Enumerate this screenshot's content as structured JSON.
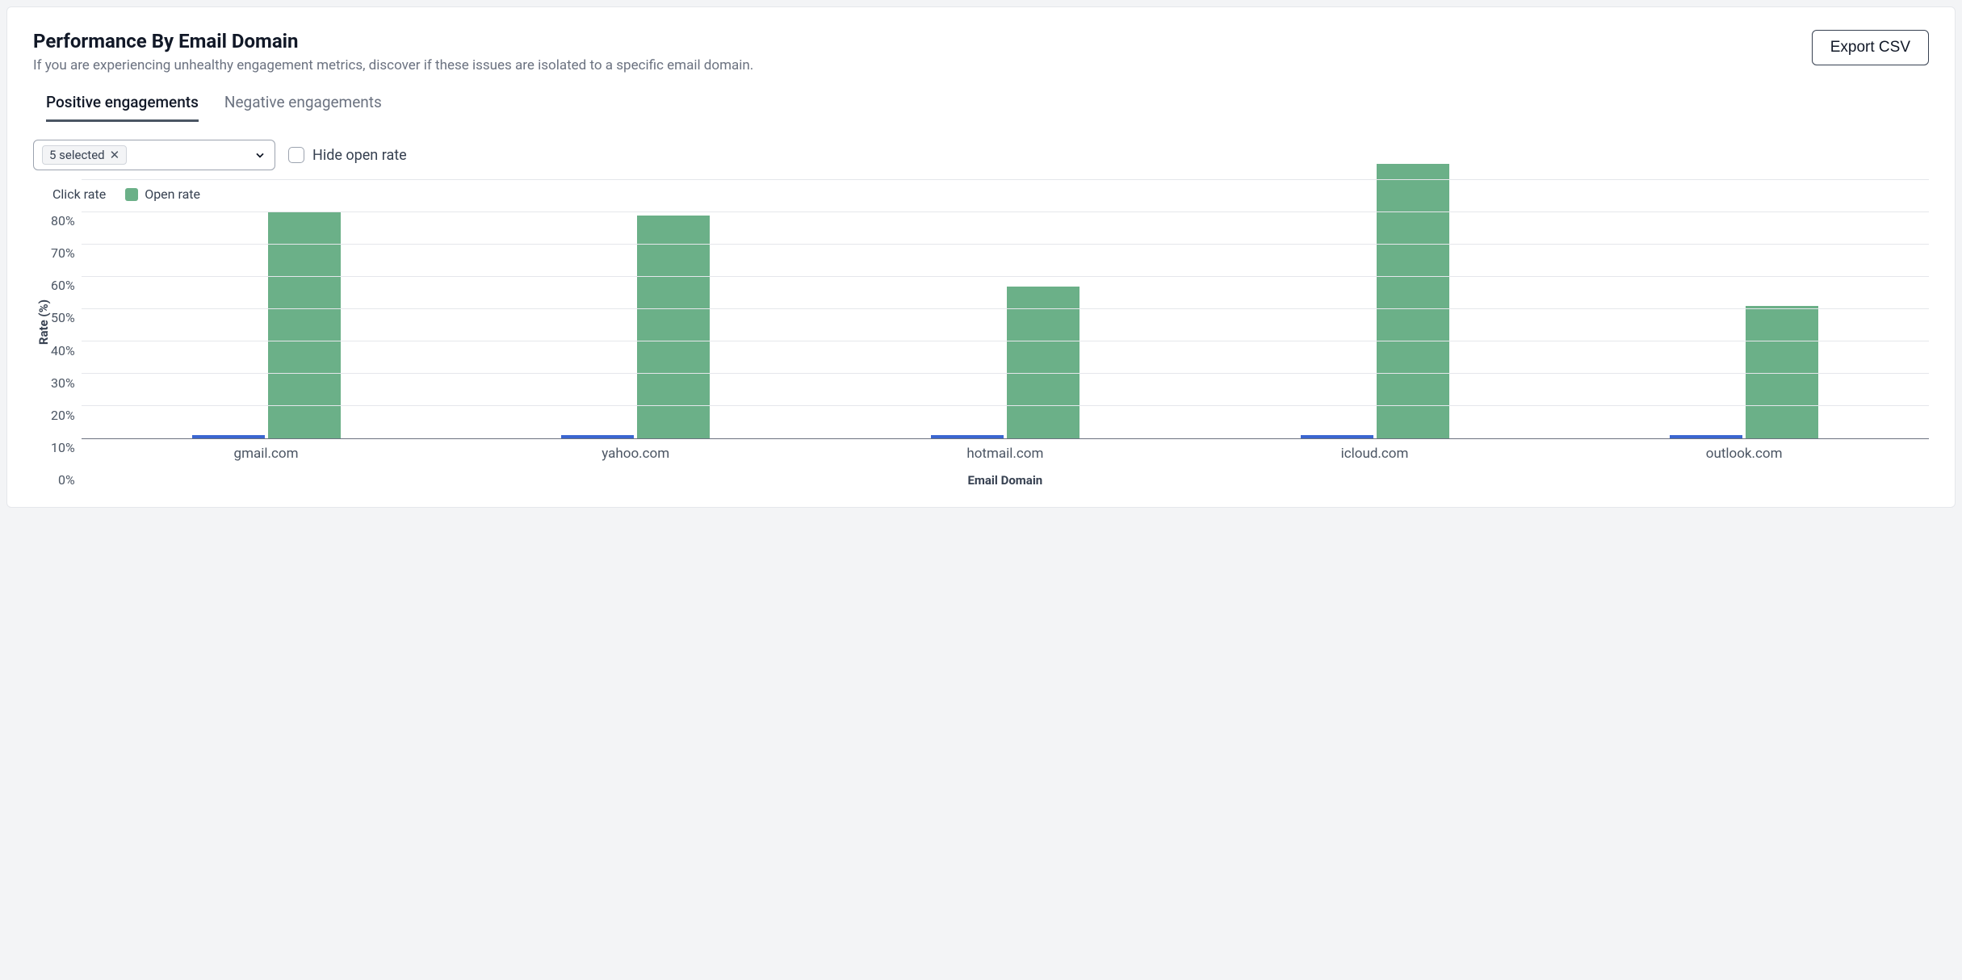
{
  "header": {
    "title": "Performance By Email Domain",
    "subtitle": "If you are experiencing unhealthy engagement metrics, discover if these issues are isolated to a specific email domain.",
    "export_label": "Export CSV"
  },
  "tabs": [
    {
      "label": "Positive engagements",
      "active": true
    },
    {
      "label": "Negative engagements",
      "active": false
    }
  ],
  "controls": {
    "selected_chip": "5 selected",
    "hide_open_rate_label": "Hide open rate"
  },
  "legend": [
    {
      "label": "Click rate",
      "color": "#3b66d1"
    },
    {
      "label": "Open rate",
      "color": "#6bb088"
    }
  ],
  "chart_data": {
    "type": "bar",
    "title": "",
    "xlabel": "Email Domain",
    "ylabel": "Rate (%)",
    "ylim": [
      0,
      85
    ],
    "yticks": [
      "80%",
      "70%",
      "60%",
      "50%",
      "40%",
      "30%",
      "20%",
      "10%",
      "0%"
    ],
    "categories": [
      "gmail.com",
      "yahoo.com",
      "hotmail.com",
      "icloud.com",
      "outlook.com"
    ],
    "series": [
      {
        "name": "Click rate",
        "color": "#3b66d1",
        "values": [
          1,
          1,
          1,
          1,
          1
        ]
      },
      {
        "name": "Open rate",
        "color": "#6bb088",
        "values": [
          70,
          69,
          47,
          85,
          41
        ]
      }
    ]
  }
}
